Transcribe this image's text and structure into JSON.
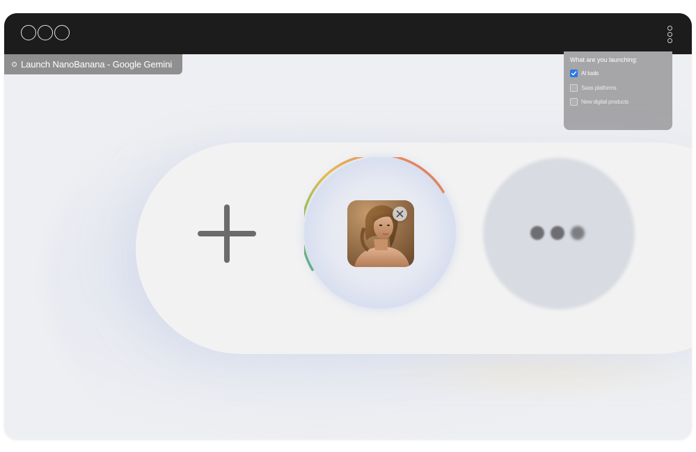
{
  "tab": {
    "title": "Launch NanoBanana - Google Gemini"
  },
  "window_controls": [
    "close-button",
    "minimize-button",
    "maximize-button"
  ],
  "survey": {
    "question": "What are you launching:",
    "options": [
      {
        "label": "AI tools",
        "checked": true
      },
      {
        "label": "Saas platforms",
        "checked": false
      },
      {
        "label": "New digital products",
        "checked": false
      }
    ]
  },
  "composer": {
    "add_icon": "plus-icon",
    "remove_icon": "close-icon",
    "more_icon": "ellipsis-icon"
  },
  "colors": {
    "titlebar": "#1c1c1c",
    "tab": "#8f8f8f",
    "checkbox_checked": "#2a78e6",
    "pill": "#f2f2f2",
    "plus": "#6b6b6b"
  }
}
